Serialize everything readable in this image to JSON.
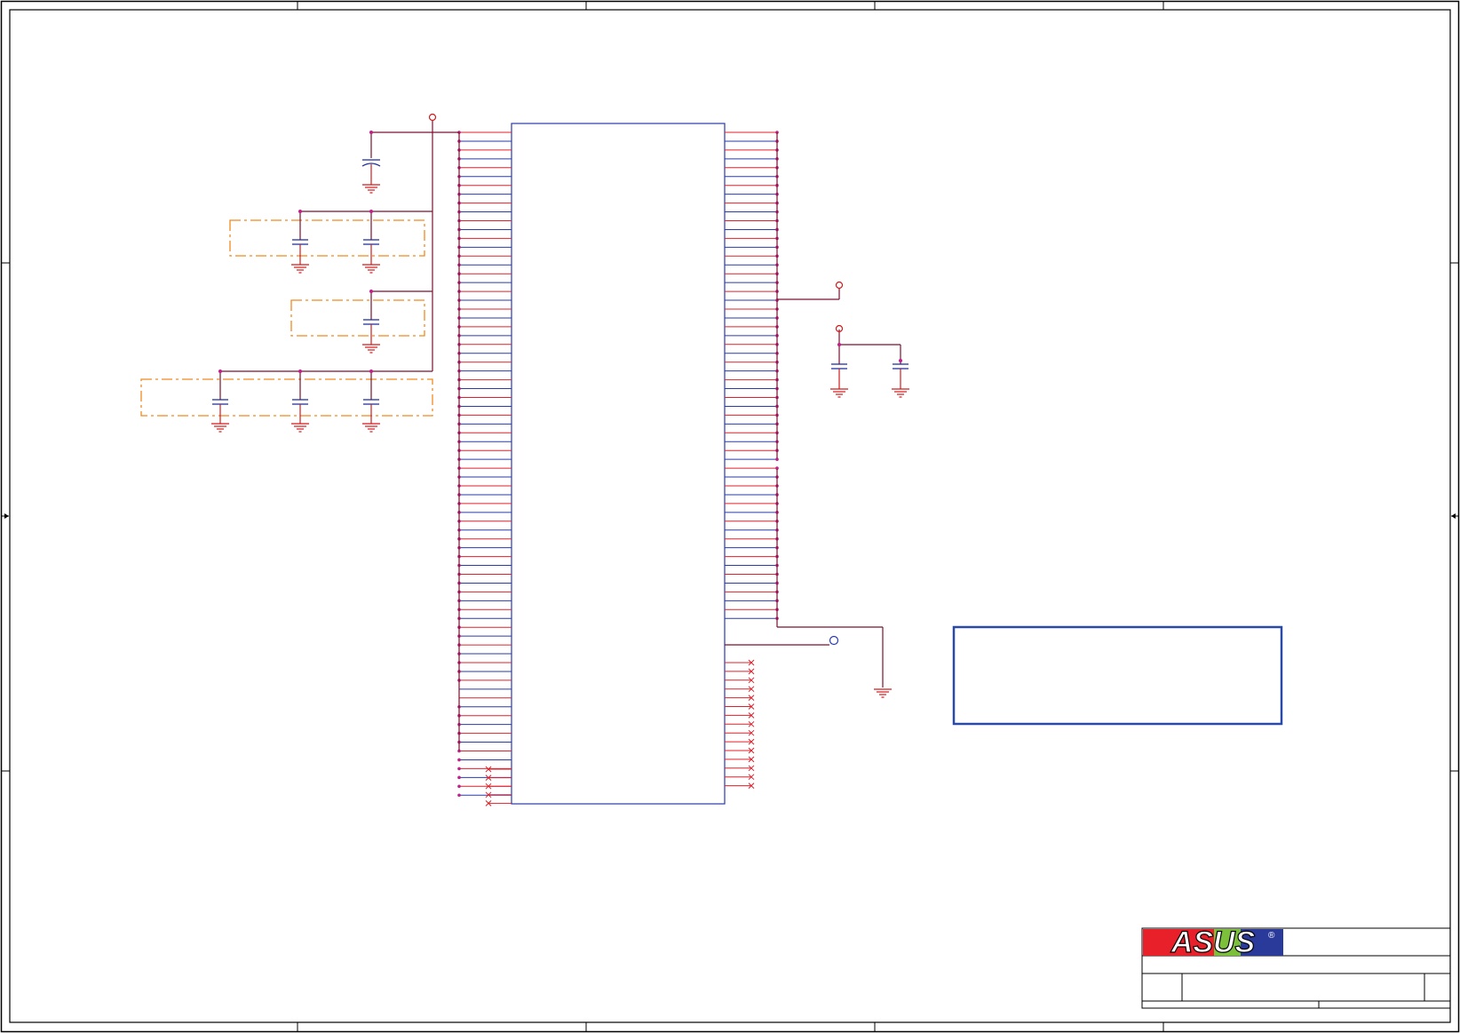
{
  "sheet": {
    "colors": {
      "frame": "#000000",
      "net_power": "#7a1030",
      "pin_line": "#e0202a",
      "pin_blue": "#2a3aa8",
      "ic_outline": "#2a3aa8",
      "junction": "#c0208a",
      "ground": "#d01a1a",
      "capacitor": "#1a2a9a",
      "group_box": "#f08a1e",
      "note_box": "#2a4aa8",
      "power_flag": "#d01a1a"
    },
    "ic": {
      "left_pin_count": 76,
      "right_pin_count": 76,
      "left_no_connect_count": 5,
      "right_no_connect_count": 15
    },
    "decoupling_groups": [
      {
        "capacitor_count": 2
      },
      {
        "capacitor_count": 1
      },
      {
        "capacitor_count": 3
      }
    ],
    "title_block": {
      "logo_text": "ASUS",
      "logo_colors": [
        "#e8202a",
        "#ffffff",
        "#2a3a9a"
      ],
      "registered_mark": "®"
    }
  }
}
